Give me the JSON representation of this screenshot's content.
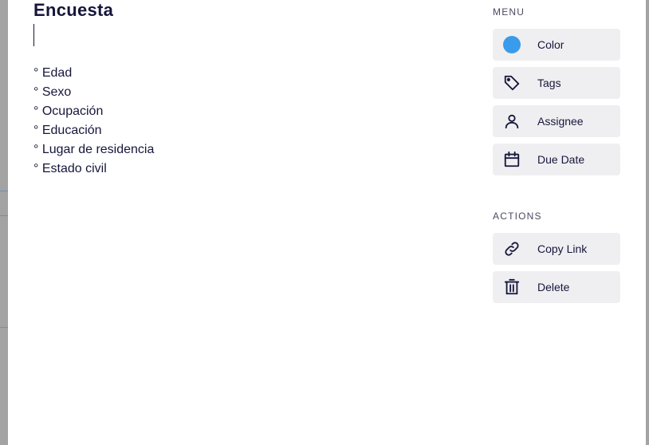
{
  "card": {
    "title": "Encuesta",
    "items": [
      "° Edad",
      "° Sexo",
      "° Ocupación",
      "° Educación",
      "° Lugar de residencia",
      "° Estado civil"
    ]
  },
  "menu": {
    "heading": "MENU",
    "color_label": "Color",
    "color_value": "#3a9bea",
    "tags_label": "Tags",
    "assignee_label": "Assignee",
    "due_date_label": "Due Date"
  },
  "actions": {
    "heading": "ACTIONS",
    "copy_link_label": "Copy Link",
    "delete_label": "Delete"
  },
  "icons": {
    "color": "color-dot-icon",
    "tags": "tag-icon",
    "assignee": "user-icon",
    "due_date": "calendar-icon",
    "copy_link": "link-icon",
    "delete": "trash-icon"
  },
  "theme": {
    "text": "#16163b",
    "button_bg": "#efeff2"
  }
}
